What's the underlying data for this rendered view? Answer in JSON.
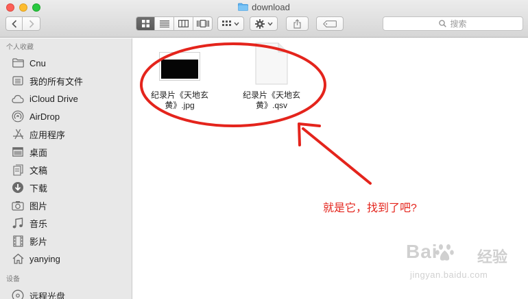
{
  "window": {
    "title": "download"
  },
  "toolbar": {
    "back_icon": "chevron-left-icon",
    "forward_icon": "chevron-right-icon",
    "view_modes": [
      "icon-view",
      "list-view",
      "column-view",
      "cover-flow-view"
    ],
    "active_view": "icon-view",
    "search_placeholder": "搜索"
  },
  "sidebar": {
    "favorites_header": "个人收藏",
    "favorites": [
      {
        "label": "Cnu",
        "icon": "folder-icon"
      },
      {
        "label": "我的所有文件",
        "icon": "all-files-icon"
      },
      {
        "label": "iCloud Drive",
        "icon": "cloud-icon"
      },
      {
        "label": "AirDrop",
        "icon": "airdrop-icon"
      },
      {
        "label": "应用程序",
        "icon": "applications-icon"
      },
      {
        "label": "桌面",
        "icon": "desktop-icon"
      },
      {
        "label": "文稿",
        "icon": "documents-icon"
      },
      {
        "label": "下载",
        "icon": "download-icon"
      },
      {
        "label": "图片",
        "icon": "camera-icon"
      },
      {
        "label": "音乐",
        "icon": "music-icon"
      },
      {
        "label": "影片",
        "icon": "film-icon"
      },
      {
        "label": "yanying",
        "icon": "home-icon"
      }
    ],
    "devices_header": "设备",
    "devices": [
      {
        "label": "远程光盘",
        "icon": "disc-icon"
      }
    ]
  },
  "files": [
    {
      "name_line1": "纪录片《天地玄",
      "name_line2": "黄》.jpg",
      "kind": "image-thumbnail"
    },
    {
      "name_line1": "纪录片《天地玄",
      "name_line2": "黄》.qsv",
      "kind": "generic-document"
    }
  ],
  "annotation": {
    "text": "就是它，找到了吧?",
    "color": "#e4241c"
  },
  "watermark": {
    "brand": "Bai",
    "sub": "经验",
    "url": "jingyan.baidu.com"
  },
  "colors": {
    "sidebar_bg": "#e8e8e8",
    "folder_blue": "#5fb3f0",
    "annotation_red": "#e4241c"
  }
}
